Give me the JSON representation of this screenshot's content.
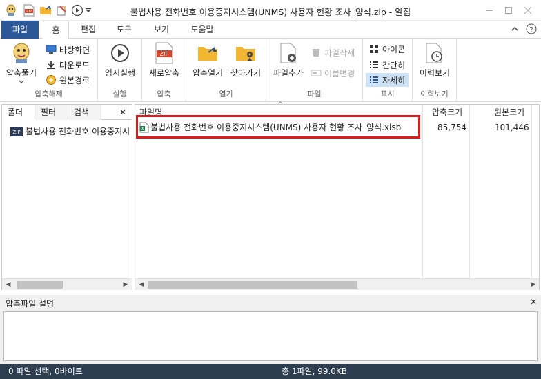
{
  "titlebar": {
    "title": "불법사용 전화번호 이용중지시스템(UNMS) 사용자 현황 조사_양식.zip - 알집",
    "quick_icons": [
      "alzip-logo-icon",
      "zip-new-icon",
      "folder-open-icon",
      "magic-icon",
      "play-icon",
      "dropdown-icon"
    ]
  },
  "ribbon_tabs": [
    "파일",
    "홈",
    "편집",
    "도구",
    "보기",
    "도움말"
  ],
  "ribbon": {
    "extract": {
      "group_label": "압축해제",
      "big_label": "압축풀기",
      "desktop": "바탕화면",
      "download": "다운로드",
      "origin": "원본경로"
    },
    "run": {
      "group_label": "실행",
      "label": "임시실행"
    },
    "compress": {
      "group_label": "압축",
      "label": "새로압축",
      "icon_text": "ZIP"
    },
    "open": {
      "group_label": "열기",
      "open_label": "압축열기",
      "find_label": "찾아가기"
    },
    "file": {
      "group_label": "파일",
      "add": "파일추가",
      "delete": "파일삭제",
      "rename": "이름변경"
    },
    "view": {
      "group_label": "표시",
      "icons": "아이콘",
      "simple": "간단히",
      "details": "자세히"
    },
    "history": {
      "group_label": "이력보기",
      "label": "이력보기"
    }
  },
  "left_panel": {
    "tabs": [
      "폴더",
      "필터",
      "검색"
    ],
    "close": "✕",
    "tree_item": "불법사용 전화번호 이용중지시스템(UNMS) 사용자 현황 조사_양식.zip",
    "zip_badge": "ZIP"
  },
  "file_list": {
    "columns": [
      "파일명",
      "압축크기",
      "원본크기"
    ],
    "sort_arrow": "^",
    "rows": [
      {
        "name": "불법사용 전화번호 이용중지시스템(UNMS) 사용자 현황 조사_양식.xlsb",
        "compressed": "85,754",
        "original": "101,446"
      }
    ]
  },
  "comment_panel": {
    "title": "압축파일 설명",
    "close": "✕"
  },
  "statusbar": {
    "left": "0 파일 선택,  0바이트",
    "center": "총 1파일,  99.0KB"
  },
  "colors": {
    "file_tab": "#2b5797",
    "statusbar": "#2d3e50",
    "highlight": "#e01b1b",
    "selected_view": "#cfe3f7"
  }
}
